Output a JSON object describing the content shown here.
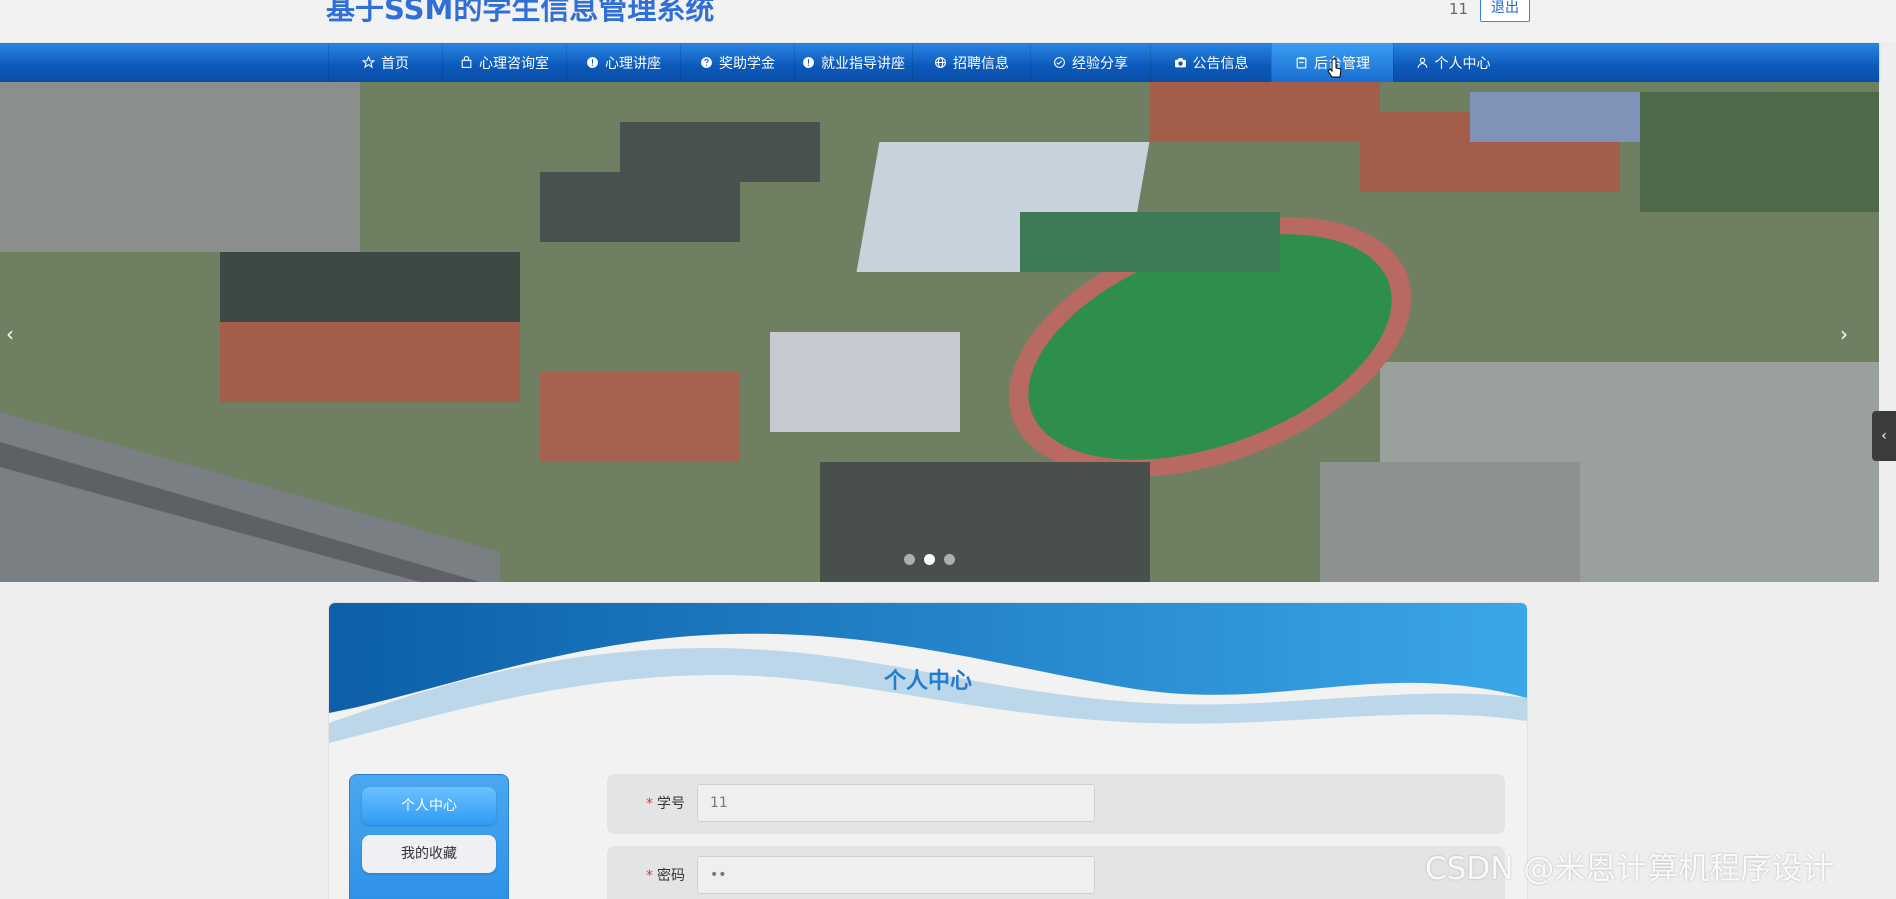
{
  "header": {
    "title": "基于SSM的学生信息管理系统",
    "username": "11",
    "logout_label": "退出"
  },
  "nav": {
    "items": [
      {
        "label": "首页",
        "icon": "star-icon"
      },
      {
        "label": "心理咨询室",
        "icon": "bag-icon"
      },
      {
        "label": "心理讲座",
        "icon": "info-icon"
      },
      {
        "label": "奖助学金",
        "icon": "question-icon"
      },
      {
        "label": "就业指导讲座",
        "icon": "info-icon"
      },
      {
        "label": "招聘信息",
        "icon": "globe-icon"
      },
      {
        "label": "经验分享",
        "icon": "check-circle-icon"
      },
      {
        "label": "公告信息",
        "icon": "camera-icon"
      },
      {
        "label": "后台管理",
        "icon": "clipboard-icon"
      },
      {
        "label": "个人中心",
        "icon": "user-icon"
      }
    ],
    "active_index": 8
  },
  "carousel": {
    "slide_count": 3,
    "active_slide": 1,
    "prev_symbol": "‹",
    "next_symbol": "›"
  },
  "side_toggle_symbol": "‹",
  "profile": {
    "title": "个人中心",
    "menu": [
      {
        "label": "个人中心",
        "active": true
      },
      {
        "label": "我的收藏",
        "active": false
      }
    ],
    "fields": [
      {
        "required_mark": "*",
        "label": "学号",
        "value": "11"
      },
      {
        "required_mark": "*",
        "label": "密码",
        "value": "••"
      }
    ]
  },
  "watermark": "CSDN @米恩计算机程序设计",
  "colors": {
    "nav_blue": "#0c58b9",
    "accent_blue": "#1f7ccf",
    "required_red": "#e33333"
  }
}
